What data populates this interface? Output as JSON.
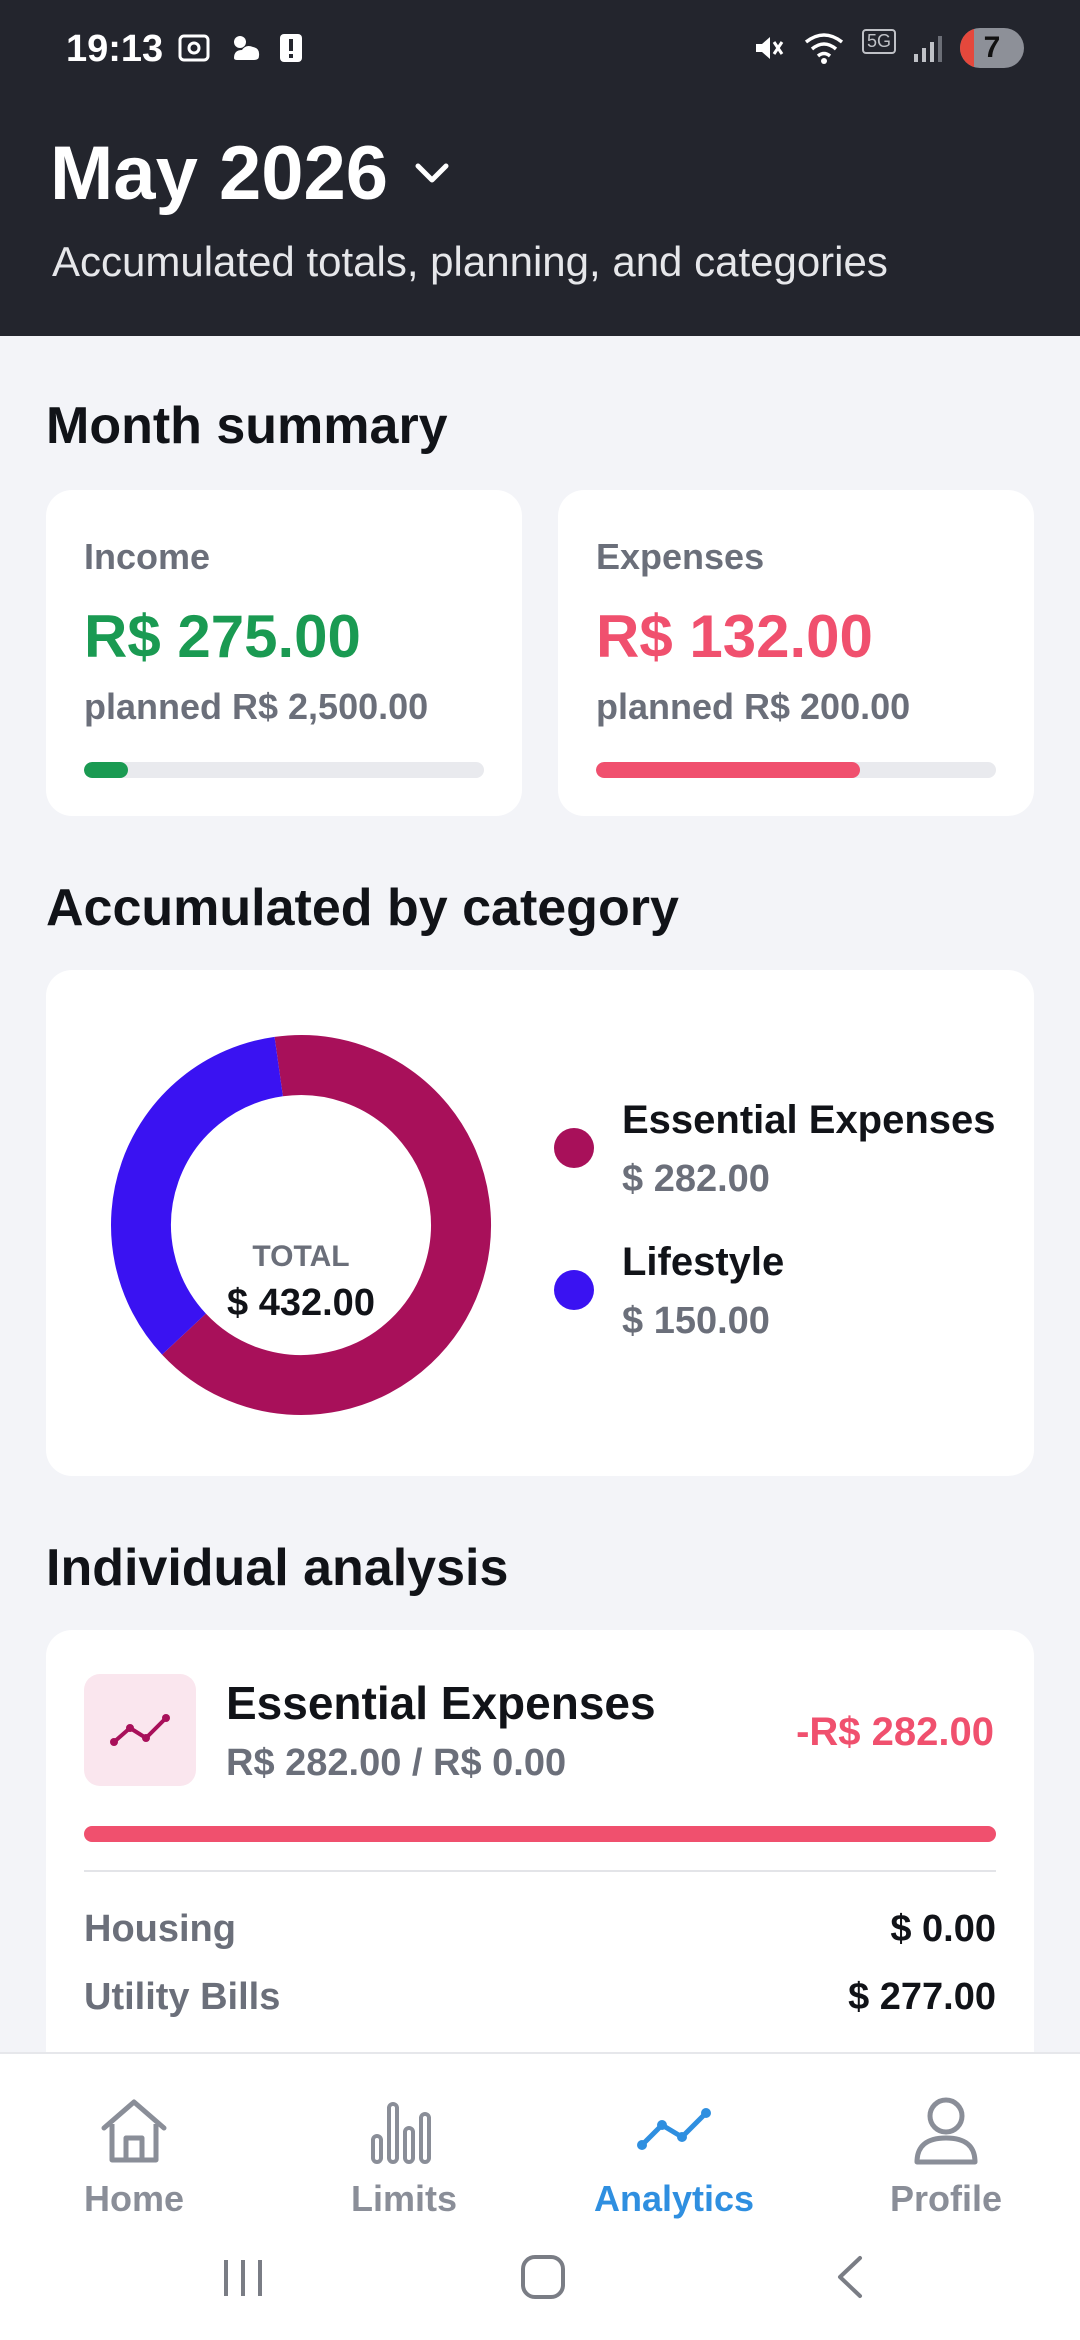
{
  "status_bar": {
    "time": "19:13",
    "battery_level": "7",
    "icons_left": [
      "screenshot-icon",
      "weather-icon",
      "alert-icon"
    ],
    "icons_right": [
      "mute-icon",
      "wifi-icon",
      "5g-icon",
      "signal-icon",
      "battery-icon"
    ],
    "network_label": "5G"
  },
  "header": {
    "month": "May 2026",
    "subtitle": "Accumulated totals, planning, and categories"
  },
  "summary": {
    "title": "Month summary",
    "income": {
      "label": "Income",
      "amount": "R$ 275.00",
      "planned": "planned R$ 2,500.00",
      "progress": 0.11,
      "color": "#1a9a52"
    },
    "expenses": {
      "label": "Expenses",
      "amount": "R$ 132.00",
      "planned": "planned R$ 200.00",
      "progress": 0.66,
      "color": "#f0506e"
    }
  },
  "categories": {
    "title": "Accumulated by category",
    "total_label": "TOTAL",
    "total_value": "$ 432.00",
    "items": [
      {
        "name": "Essential Expenses",
        "value": "$ 282.00",
        "amount": 282,
        "color": "#a8105a"
      },
      {
        "name": "Lifestyle",
        "value": "$ 150.00",
        "amount": 150,
        "color": "#3a12f2"
      }
    ]
  },
  "individual": {
    "title": "Individual analysis",
    "category": {
      "icon": "trend-line-icon",
      "name": "Essential Expenses",
      "ratio": "R$ 282.00 / R$ 0.00",
      "delta": "-R$ 282.00",
      "progress": 1.0,
      "subitems": [
        {
          "name": "Housing",
          "value": "$ 0.00"
        },
        {
          "name": "Utility Bills",
          "value": "$ 277.00"
        }
      ]
    }
  },
  "nav": {
    "items": [
      {
        "label": "Home",
        "icon": "home-icon",
        "active": false
      },
      {
        "label": "Limits",
        "icon": "bar-chart-icon",
        "active": false
      },
      {
        "label": "Analytics",
        "icon": "analytics-icon",
        "active": true
      },
      {
        "label": "Profile",
        "icon": "profile-icon",
        "active": false
      }
    ],
    "active_color": "#2f8fe0"
  },
  "system_nav": [
    "recents-icon",
    "home-circle-icon",
    "back-icon"
  ]
}
